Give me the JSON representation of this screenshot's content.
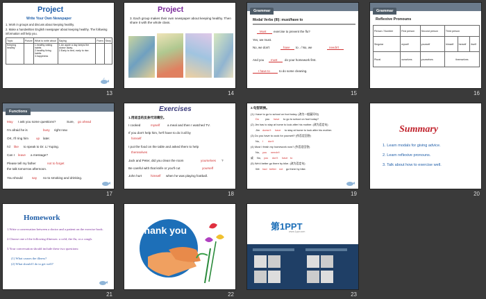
{
  "slides": [
    {
      "number": "13",
      "title": "Project",
      "subtitle": "Write Your Own Newspaper",
      "lines": [
        "1. Work in groups and discuss about keeping healthy.",
        "2. Make a handwritten English newspaper about keeping healthy. The following information will help you."
      ],
      "table_headers": [
        "Topic",
        "Picture",
        "What to write about",
        "Saying",
        "Poem",
        "Story"
      ],
      "table_cells": [
        "Keeping healthy",
        "1.healthy eating habits",
        "2.healthy living habits",
        "3.happiness",
        "1.An apple a day keeps the doctor away.",
        "2.Early to bed, early to rise."
      ]
    },
    {
      "number": "14",
      "title": "Project",
      "text": "3. Each group makes their own newspaper about keeping healthy. Then share it with the whole class."
    },
    {
      "number": "15",
      "tab": "Grammar",
      "heading": "Modal Verbs (III): must/have to",
      "lines": [
        "exercise to prevent the flu?",
        "Yes, we must.",
        "No, we don't",
        "to . / No, we",
        "And you",
        "do your homework first.",
        "to do some cleaning."
      ],
      "answers": [
        "Must",
        "have",
        "needn't",
        "must",
        "I have to"
      ]
    },
    {
      "number": "16",
      "tab": "Grammar",
      "heading": "Reflexive Pronouns",
      "headers": [
        "Person / Number",
        "First person",
        "Second person",
        "Third person"
      ],
      "singular_label": "Singular",
      "plural_label": "Plural",
      "singular": [
        "myself",
        "yourself",
        "himself",
        "herself",
        "itself"
      ],
      "plural": [
        "ourselves",
        "yourselves",
        "themselves"
      ]
    },
    {
      "number": "17",
      "tab": "Functions",
      "lines": [
        "May",
        "I ask you some questions?",
        "Sure,",
        "go ahead",
        "I'm afraid he is",
        "busy",
        "right now.",
        "OK, I'll ring him",
        "up",
        "later.",
        "I'd",
        "like",
        "to speak to Dr. Li Yuping.",
        "Can I",
        "leave",
        "a message?",
        "Please tell my father",
        "not to forget",
        "the talk tomorrow afternoon.",
        "You should",
        "say",
        "no to smoking and drinking."
      ]
    },
    {
      "number": "18",
      "title": "Exercises",
      "instruction": "1.用适当的反身代词填空。",
      "items": [
        "I cooked",
        "a meal and then I watched TV.",
        "If you don't help him, he'll have to do it all by",
        "I put the food on the table and asked them to help",
        "Jack and Peter, did you clean the room",
        "?",
        "Be careful with that knife or you'll cut",
        "John hurt",
        "when he was playing football."
      ],
      "answers": [
        "myself",
        "himself",
        "themselves",
        "yourselves",
        "yourself",
        "himself"
      ]
    },
    {
      "number": "19",
      "instruction": "2.句型转换。",
      "items": [
        "(1) I have to go to school on foot today. (改为一般疑问句)",
        "Do",
        "you",
        "have",
        "to go to school on foot today?",
        "(2) Jim has to stay at home to look after his mother. (改为否定句)",
        "Jim",
        "doesn't",
        "have",
        "to stay at home to look after his mother.",
        "(3) Do you have to cook for yourself? (作否定回答)",
        "No,",
        "I",
        "don't",
        "(4) Must I finish my homework now? (作否定回答)",
        "No,",
        "you",
        "needn't",
        "或",
        "No,",
        "you",
        "don't",
        "have",
        "to",
        "(5) We'd better go there by bike. (改为否定句)",
        "We",
        "had",
        "better",
        "not",
        "go there by bike."
      ]
    },
    {
      "number": "20",
      "title": "Summary",
      "items": [
        "1. Learn modals for giving advice.",
        "2. Learn reflexive pronouns.",
        "3. Talk about how to exercise well."
      ]
    },
    {
      "number": "21",
      "title": "Homework",
      "items": [
        "1.Write a conversation between a doctor and a patient on the exercise book.",
        "2.Choose one of the following illnesses: a cold, the flu, or a cough.",
        "3.Your conversation should include these two questions:",
        "(1) What causes the illness?",
        "(2) What should I do to get well?"
      ]
    },
    {
      "number": "22",
      "caption": "Thank you"
    },
    {
      "number": "23",
      "logo": "第1PPT",
      "site": "www.1ppt.com"
    }
  ],
  "colors": {
    "background": "#3a3a3a",
    "title_blue": "#1f5ea8",
    "title_purple": "#7a2a9a",
    "summary_red": "#c0202a",
    "answer_red": "#d03030"
  }
}
